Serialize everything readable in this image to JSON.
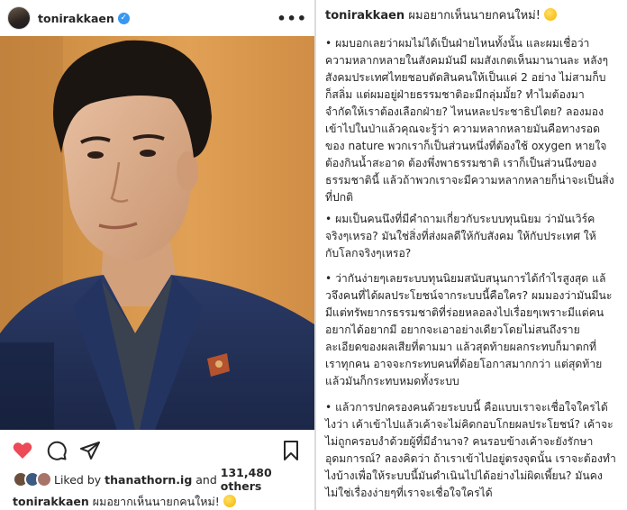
{
  "post": {
    "username": "tonirakkaen",
    "verified_icon": "verified-badge-icon",
    "more_icon": "more-options-icon",
    "photo_desc": "portrait-photo",
    "actions": {
      "like_icon": "heart-icon-filled",
      "comment_icon": "comment-icon",
      "share_icon": "share-icon",
      "save_icon": "bookmark-icon",
      "like_color": "#ed4956"
    },
    "liked_by": {
      "prefix": "Liked by ",
      "user": "thanathorn.ig",
      "middle": " and ",
      "count": "131,480 others"
    },
    "caption_username": "tonirakkaen",
    "caption_text": "ผมอยากเห็นนายกคนใหม่!",
    "caption_emoji": "grimacing-face-emoji"
  },
  "caption_panel": {
    "username": "tonirakkaen",
    "headline": "ผมอยากเห็นนายกคนใหม่!",
    "paragraphs": [
      {
        "lines": [
          "• ผมบอกเลยว่าผมไม่ได้เป็นฝ่ายไหนทั้งนั้น และผมเชื่อว่า",
          "ความหลากหลายในสังคมมันมี ผมสังเกตเห็นมานานละ หลังๆ",
          "สังคมประเทศไทยชอบตัดสินคนให้เป็นแค่ 2 อย่าง ไม่สามก็บ",
          "ก็สลิ่ม แต่ผมอยู่ฝ่ายธรรมชาติอะมีกลุ่มมั้ย? ทำไมต้องมา",
          "จำกัดให้เราต้องเลือกฝ่าย? ไหนหละประชาธิปไตย? ลองมอง",
          "เข้าไปในป่าแล้วคุณจะรู้ว่า ความหลากหลายมันคือทางรอด",
          "ของ nature พวกเราก็เป็นส่วนหนึ่งที่ต้องใช้ oxygen หายใจ",
          "ต้องกินน้ำสะอาด ต้องพึ่งพาธรรมชาติ เราก็เป็นส่วนนึงของ",
          "ธรรมชาตินี้ แล้วถ้าพวกเราจะมีความหลากหลายก็น่าจะเป็นสิ่ง",
          "ที่ปกติ"
        ]
      },
      {
        "lines": [
          "• ผมเป็นคนนึงที่มีคำถามเกี่ยวกับระบบทุนนิยม ว่ามันเวิร์ค",
          "จริงๆเหรอ? มันใช่สิ่งที่ส่งผลดีให้กับสังคม ให้กับประเทศ ให้",
          "กับโลกจริงๆเหรอ?"
        ]
      },
      {
        "lines": [
          "• ว่ากันง่ายๆเลยระบบทุนนิยมสนับสนุนการได้กำไรสูงสุด แล้",
          "วจึงคนที่ได้ผลประโยชน์จากระบบนี้คือใคร? ผมมองว่ามันมีนะ",
          "มีแต่ทรัพยากรธรรมชาติที่ร่อยหลอลงไปเรื่อยๆเพราะมีแต่คน",
          "อยากได้อยากมี อยากจะเอาอย่างเดียวโดยไม่สนถึงราย",
          "ละเอียดของผลเสียที่ตามมา แล้วสุดท้ายผลกระทบก็มาตกที่",
          "เราทุกคน อาจจะกระทบคนที่ด้อยโอกาสมากกว่า แต่สุดท้าย",
          "แล้วมันก็กระทบหมดทั้งระบบ"
        ]
      },
      {
        "lines": [
          "• แล้วการปกครองคนด้วยระบบนี้ คือแบบเราจะเชื่อใจใครได้",
          "ไงว่า เค้าเข้าไปแล้วเค้าจะไม่คิดกอบโกยผลประโยชน์? เค้าจะ",
          "ไม่ถูกครอบงำด้วยผู้ที่มีอำนาจ? คนรอบข้างเค้าจะยังรักษา",
          "อุดมการณ์? ลองคิดว่า ถ้าเราเข้าไปอยู่ตรงจุดนั้น เราจะต้องทำ",
          "ไงบ้างเพื่อให้ระบบนี้มันดำเนินไปได้อย่างไม่ผิดเพี้ยน? มันคง",
          "ไม่ใช่เรื่องง่ายๆที่เราจะเชื่อใจใครได้"
        ]
      }
    ]
  }
}
